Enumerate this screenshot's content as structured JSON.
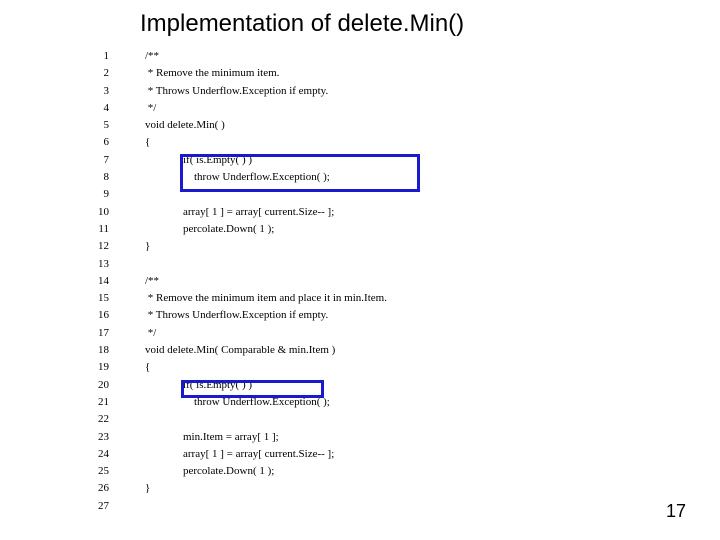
{
  "title": "Implementation of delete.Min()",
  "lines": [
    {
      "n": "1",
      "indent": 1,
      "text": "/**"
    },
    {
      "n": "2",
      "indent": 1,
      "text": " * Remove the minimum item."
    },
    {
      "n": "3",
      "indent": 1,
      "text": " * Throws Underflow.Exception if empty."
    },
    {
      "n": "4",
      "indent": 1,
      "text": " */"
    },
    {
      "n": "5",
      "indent": 1,
      "text": "void delete.Min( )"
    },
    {
      "n": "6",
      "indent": 1,
      "text": "{"
    },
    {
      "n": "7",
      "indent": 2,
      "text": "if( is.Empty( ) )"
    },
    {
      "n": "8",
      "indent": 2,
      "text": "    throw Underflow.Exception( );"
    },
    {
      "n": "9",
      "indent": 1,
      "text": ""
    },
    {
      "n": "10",
      "indent": 2,
      "text": "array[ 1 ] = array[ current.Size-- ];"
    },
    {
      "n": "11",
      "indent": 2,
      "text": "percolate.Down( 1 );"
    },
    {
      "n": "12",
      "indent": 1,
      "text": "}"
    },
    {
      "n": "13",
      "indent": 1,
      "text": ""
    },
    {
      "n": "14",
      "indent": 1,
      "text": "/**"
    },
    {
      "n": "15",
      "indent": 1,
      "text": " * Remove the minimum item and place it in min.Item."
    },
    {
      "n": "16",
      "indent": 1,
      "text": " * Throws Underflow.Exception if empty."
    },
    {
      "n": "17",
      "indent": 1,
      "text": " */"
    },
    {
      "n": "18",
      "indent": 1,
      "text": "void delete.Min( Comparable & min.Item )"
    },
    {
      "n": "19",
      "indent": 1,
      "text": "{"
    },
    {
      "n": "20",
      "indent": 2,
      "text": "if( is.Empty( ) )"
    },
    {
      "n": "21",
      "indent": 2,
      "text": "    throw Underflow.Exception( );"
    },
    {
      "n": "22",
      "indent": 1,
      "text": ""
    },
    {
      "n": "23",
      "indent": 2,
      "text": "min.Item = array[ 1 ];"
    },
    {
      "n": "24",
      "indent": 2,
      "text": "array[ 1 ] = array[ current.Size-- ];"
    },
    {
      "n": "25",
      "indent": 2,
      "text": "percolate.Down( 1 );"
    },
    {
      "n": "26",
      "indent": 1,
      "text": "}"
    },
    {
      "n": "27",
      "indent": 1,
      "text": ""
    }
  ],
  "page_number": "17"
}
